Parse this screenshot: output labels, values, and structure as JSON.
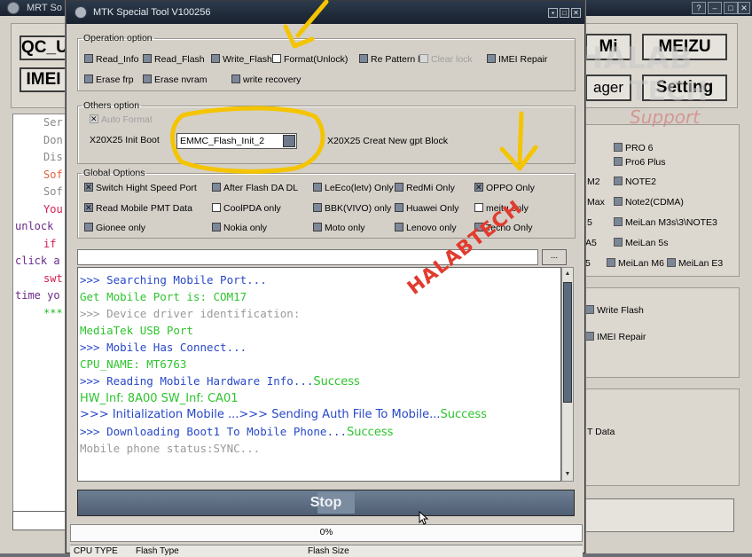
{
  "background_window": {
    "title": "MRT So",
    "buttons": [
      "QC_U",
      "IMEI",
      "Mi",
      "MEIZU",
      "ager",
      "Setting"
    ],
    "console_lines": [
      "Ser",
      "Don",
      "Dis",
      "Sof",
      "Sof",
      "You",
      "unlock",
      "if",
      "click a",
      "swt",
      "time yo",
      "***"
    ],
    "models": [
      {
        "label": "PRO 6"
      },
      {
        "label": "Pro6 Plus"
      },
      {
        "label": "M2"
      },
      {
        "label": "NOTE2"
      },
      {
        "label": "Max"
      },
      {
        "label": "Note2(CDMA)"
      },
      {
        "label": "5"
      },
      {
        "label": "MeiLan M3s\\3\\NOTE3"
      },
      {
        "label": "A5"
      },
      {
        "label": "MeiLan 5s"
      },
      {
        "label": "5"
      },
      {
        "label": "MeiLan M6"
      },
      {
        "label": "MeiLan E3"
      }
    ],
    "write_flash": "Write Flash",
    "imei_repair": "IMEI Repair",
    "t_data": "T Data",
    "controls": {
      "help": "?",
      "min": "–",
      "max": "□",
      "close": "✕"
    }
  },
  "watermark": {
    "brand1": "HALAB",
    "brand2": "TECH",
    "tagline": "Support"
  },
  "window": {
    "title": "MTK Special Tool V100256",
    "controls": {
      "min": "▪",
      "max": "□",
      "close": "✕"
    }
  },
  "operation": {
    "legend": "Operation option",
    "items": [
      {
        "label": "Read_Info"
      },
      {
        "label": "Read_Flash"
      },
      {
        "label": "Write_Flash"
      },
      {
        "label": "Format(Unlock)"
      },
      {
        "label": "Re Pattern lo"
      },
      {
        "label": "Clear lock"
      },
      {
        "label": "IMEI Repair"
      },
      {
        "label": "Erase frp"
      },
      {
        "label": "Erase nvram"
      },
      {
        "label": "write recovery"
      }
    ]
  },
  "others": {
    "legend": "Others option",
    "auto_format": "Auto Format",
    "init_boot_label": "X20X25 Init Boot",
    "init_boot_value": "EMMC_Flash_Init_2",
    "creat_gpt": "X20X25 Creat New gpt Block"
  },
  "global": {
    "legend": "Global Options",
    "items": [
      {
        "label": "Switch Hight Speed Port"
      },
      {
        "label": "After Flash DA DL"
      },
      {
        "label": "LeEco(letv) Only"
      },
      {
        "label": "RedMi Only"
      },
      {
        "label": "OPPO Only"
      },
      {
        "label": "Read Mobile PMT Data"
      },
      {
        "label": "CoolPDA only"
      },
      {
        "label": "BBK(VIVO) only"
      },
      {
        "label": "Huawei Only"
      },
      {
        "label": "meitu only"
      },
      {
        "label": "Gionee only"
      },
      {
        "label": "Nokia only"
      },
      {
        "label": "Moto only"
      },
      {
        "label": "Lenovo only"
      },
      {
        "label": "Tecno Only"
      }
    ]
  },
  "browse_label": "...",
  "log": [
    {
      "prefix": ">>> ",
      "text": "Searching Mobile Port...",
      "suffix": ""
    },
    {
      "prefix": "    ",
      "text": "Get Mobile Port is:  COM17",
      "suffix": ""
    },
    {
      "prefix": ">>> ",
      "text": "Device driver identification:",
      "suffix": ""
    },
    {
      "prefix": "    ",
      "text": "MediaTek USB Port",
      "suffix": ""
    },
    {
      "prefix": ">>> ",
      "text": "Mobile Has Connect...",
      "suffix": ""
    },
    {
      "prefix": "    ",
      "text": "CPU_NAME: MT6763",
      "suffix": ""
    },
    {
      "prefix": ">>> ",
      "text": "Reading Mobile Hardware Info...",
      "suffix": "Success"
    },
    {
      "prefix": "    ",
      "text": "HW_Inf: ",
      "suffix": "8A00",
      "text2": "  SW_Inf: ",
      "suffix2": "CA01"
    },
    {
      "prefix": ">>> ",
      "text": "Initialization Mobile ...>>> Sending Auth File To Mobile...",
      "suffix": "Success"
    },
    {
      "prefix": ">>> ",
      "text": "Downloading Boot1 To Mobile Phone...",
      "suffix": "Success"
    },
    {
      "prefix": "    ",
      "text": "Mobile phone status:SYNC...",
      "suffix": ""
    }
  ],
  "stop_label": "Stop",
  "progress": {
    "text": "0%",
    "value": 0
  },
  "table_headers": [
    "CPU TYPE",
    "Flash Type",
    "Flash Size"
  ],
  "overlay_text": "HALABTECH",
  "colors": {
    "annotation_yellow": "#f5c400",
    "overlay_red": "#e23b2f",
    "log_blue": "#2848c8",
    "log_green": "#2ec42e"
  }
}
